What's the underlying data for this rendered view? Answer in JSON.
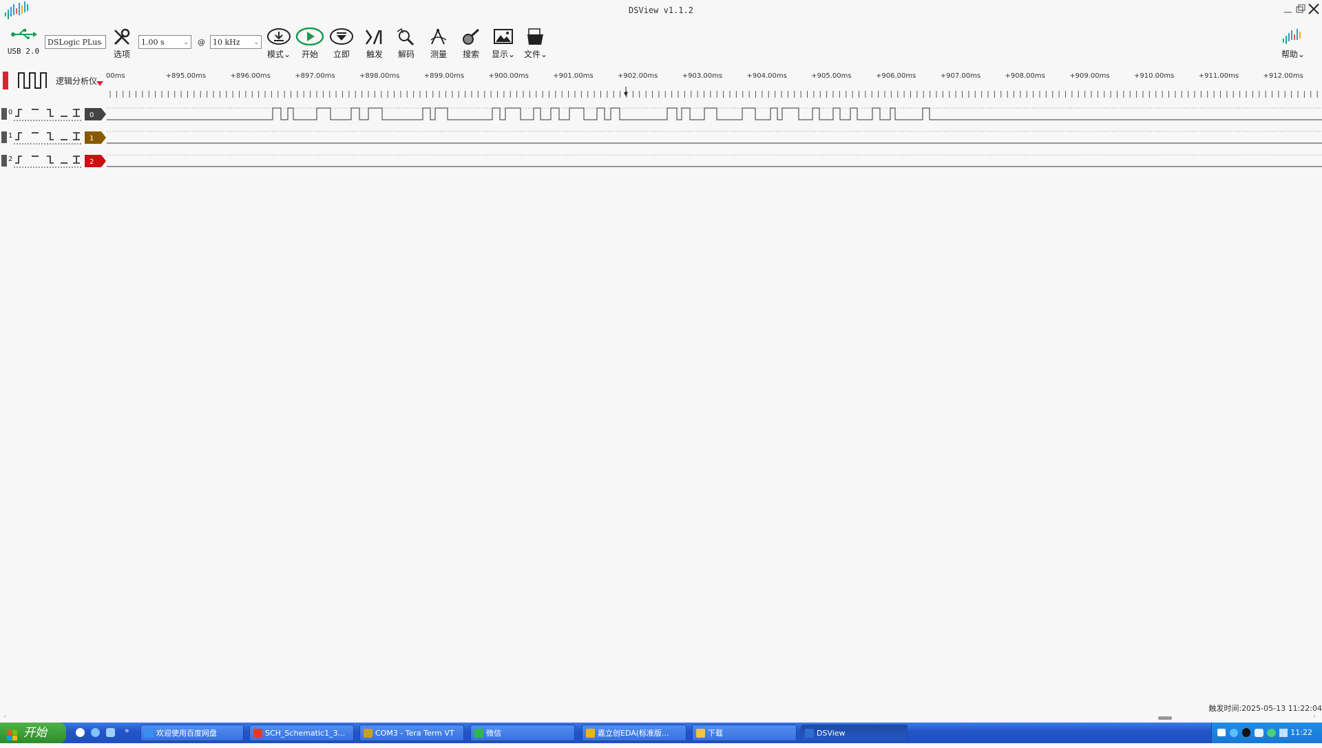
{
  "window": {
    "title": "DSView v1.1.2",
    "minimize_label": "_",
    "restore_label": "❐",
    "close_label": "✕"
  },
  "toolbar": {
    "usb_label": "USB 2.0",
    "device_select": "DSLogic PLus",
    "options_label": "选项",
    "duration_select": "1.00 s",
    "at_label": "@",
    "samplerate_select": "10 kHz",
    "mode_label": "模式",
    "start_label": "开始",
    "instant_label": "立即",
    "trigger_label": "触发",
    "decode_label": "解码",
    "measure_label": "测量",
    "search_label": "搜索",
    "display_label": "显示",
    "file_label": "文件",
    "help_label": "帮助"
  },
  "ruler": {
    "mode_label": "逻辑分析仪",
    "ticks": [
      "00ms",
      "+895.00ms",
      "+896.00ms",
      "+897.00ms",
      "+898.00ms",
      "+899.00ms",
      "+900.00ms",
      "+901.00ms",
      "+902.00ms",
      "+903.00ms",
      "+904.00ms",
      "+905.00ms",
      "+906.00ms",
      "+907.00ms",
      "+908.00ms",
      "+909.00ms",
      "+910.00ms",
      "+911.00ms",
      "+912.00ms"
    ]
  },
  "channels": [
    {
      "index_label": "0",
      "tag": "0",
      "color": "#444444"
    },
    {
      "index_label": "1",
      "tag": "1",
      "color": "#8a5a00"
    },
    {
      "index_label": "2",
      "tag": "2",
      "color": "#cc1111"
    }
  ],
  "status": {
    "trigger_time": "触发时间:2025-05-13 11:22:04"
  },
  "taskbar": {
    "start_label": "开始",
    "tasks": [
      {
        "label": "欢迎使用百度网盘",
        "color": "#3a8ef0"
      },
      {
        "label": "SCH_Schematic1_3...",
        "color": "#e23a2a"
      },
      {
        "label": "COM3 - Tera Term VT",
        "color": "#c8a020"
      },
      {
        "label": "微信",
        "color": "#2fb84a"
      },
      {
        "label": "嘉立创EDA(标准版...",
        "color": "#f0b020"
      },
      {
        "label": "下载",
        "color": "#f2c24a"
      },
      {
        "label": "DSView",
        "color": "#2f6fd0"
      }
    ],
    "clock": "11:22"
  }
}
